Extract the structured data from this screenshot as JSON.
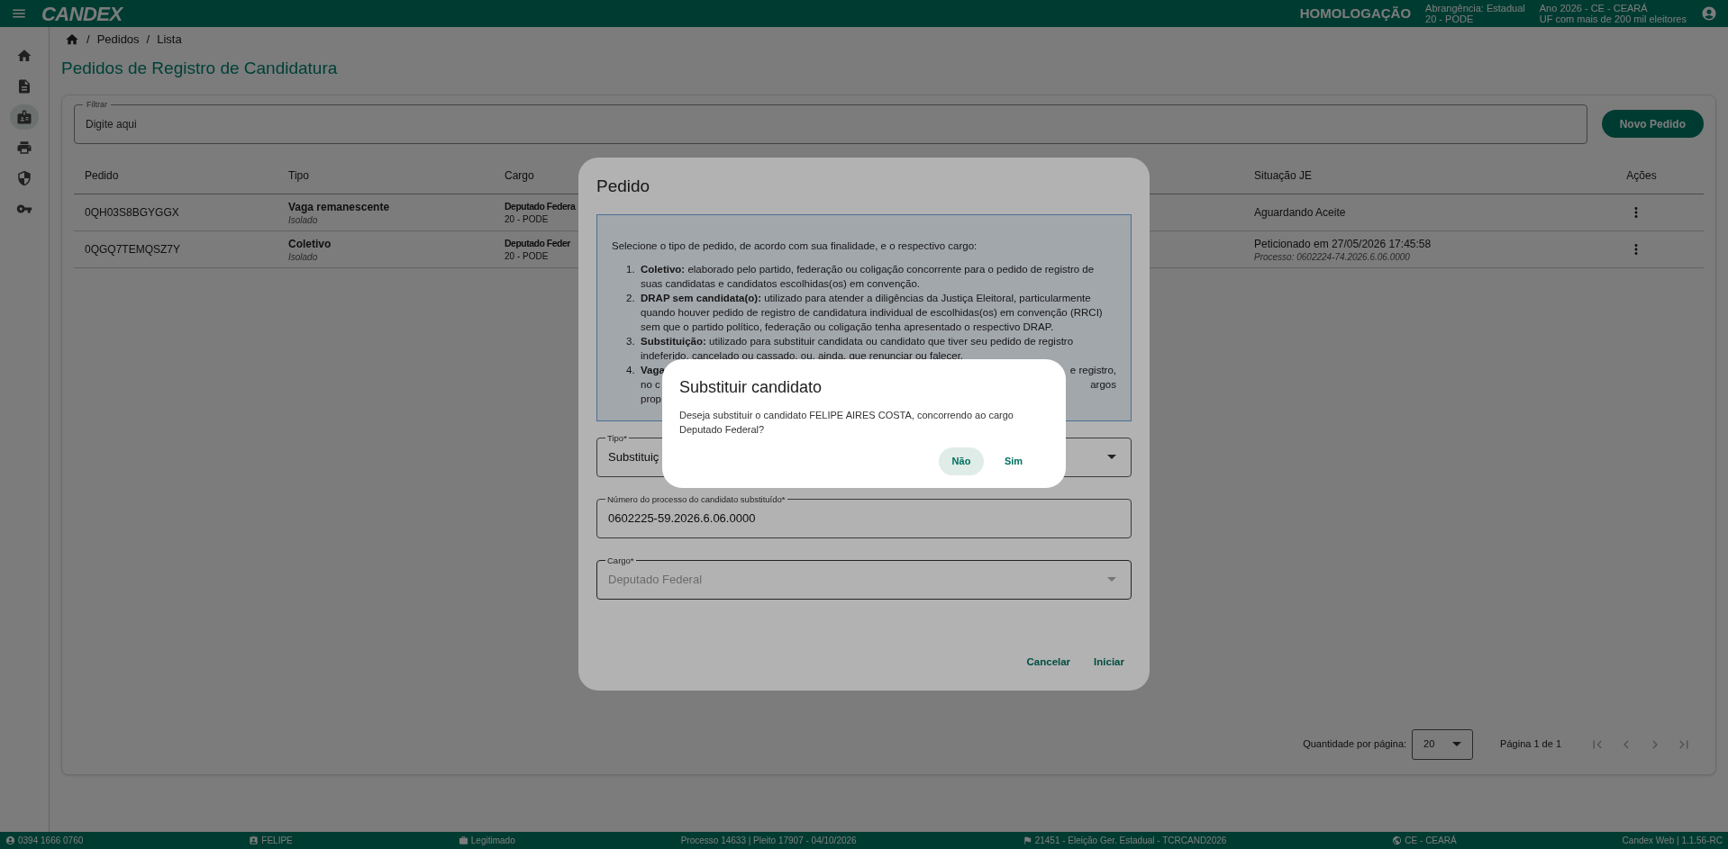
{
  "top_bar": {
    "logo": "CANDEX",
    "environment": "HOMOLOGAÇÃO",
    "scope": [
      "Abrangência: Estadual",
      "20 - PODE"
    ],
    "election": [
      "Ano 2026 - CE - CEARÁ",
      "UF com mais de 200 mil eleitores"
    ]
  },
  "sidebar": {
    "items": [
      {
        "kind": "home",
        "selected": false
      },
      {
        "kind": "document",
        "selected": false
      },
      {
        "kind": "badge",
        "selected": true
      },
      {
        "kind": "print",
        "selected": false
      },
      {
        "kind": "shield",
        "selected": false
      },
      {
        "kind": "key",
        "selected": false
      }
    ]
  },
  "breadcrumb": [
    {
      "separator": "/",
      "label": "Pedidos"
    },
    {
      "separator": "/",
      "label": "Lista"
    }
  ],
  "page_title": "Pedidos de Registro de Candidatura",
  "filter": {
    "label": "Filtrar",
    "placeholder": "Digite aqui"
  },
  "new_button": "Novo Pedido",
  "table": {
    "columns": [
      "Pedido",
      "Tipo",
      "Cargo",
      "Situação JE",
      "Ações"
    ],
    "rows": [
      {
        "pedido": "0QH03S8BGYGGX",
        "tipo": "Vaga remanescente",
        "tipo_sub": "Isolado",
        "cargo": "Deputado Federa",
        "cargo_sub": "20 - PODE",
        "situacao": "Aguardando Aceite"
      },
      {
        "pedido": "0QGQ7TEMQSZ7Y",
        "tipo": "Coletivo",
        "tipo_sub": "Isolado",
        "cargo": "Deputado Feder",
        "cargo_sub": "20 - PODE",
        "situacao": "Peticionado em 27/05/2026 17:45:58",
        "situacao_sub": "Processo: 0602224-74.2026.6.06.0000"
      }
    ]
  },
  "pagination": {
    "page_size_label": "Quantidade por página:",
    "page_size": "20",
    "page_info": "Página 1 de 1",
    "nav": [
      {
        "kind": "first",
        "disabled": true
      },
      {
        "kind": "prev",
        "disabled": true
      },
      {
        "kind": "next",
        "disabled": true
      },
      {
        "kind": "last",
        "disabled": true
      }
    ]
  },
  "pedido_dialog": {
    "title": "Pedido",
    "intro": "Selecione o tipo de pedido, de acordo com sua finalidade, e o respectivo cargo:",
    "items": [
      {
        "number": "1.",
        "text": "**Coletivo:** elaborado pelo partido, federação ou coligação concorrente para o pedido de registro de suas candidatas e candidatos escolhidas(os) em convenção."
      },
      {
        "number": "2.",
        "text": "**DRAP sem candidata(o):** utilizado para atender a diligências da Justiça Eleitoral, particularmente quando houver pedido de registro de candidatura individual de escolhidas(os) em convenção (RRCI) sem que o partido político, federação ou coligação tenha apresentado o respectivo DRAP."
      },
      {
        "number": "3.",
        "text": "**Substituição:** utilizado para substituir candidata ou candidato que tiver seu pedido de registro indeferido, cancelado ou cassado, ou, ainda, que renunciar ou falecer."
      }
    ],
    "partial_item": {
      "number": "4.",
      "lines": [
        [
          "Vaga",
          "e registro,"
        ],
        [
          "no c",
          "argos"
        ],
        [
          "prop"
        ]
      ]
    },
    "fields": [
      {
        "kind": "select",
        "label": "Tipo*",
        "value": "Substituiç",
        "disabled": false
      },
      {
        "kind": "text",
        "label": "Número do processo do candidato substituído*",
        "value": "0602225-59.2026.6.06.0000",
        "disabled": false
      },
      {
        "kind": "select",
        "label": "Cargo*",
        "value": "Deputado Federal",
        "disabled": true
      }
    ],
    "buttons": [
      "Cancelar",
      "Iniciar"
    ]
  },
  "confirm_dialog": {
    "title": "Substituir candidato",
    "message": "Deseja substituir o candidato FELIPE AIRES COSTA, concorrendo ao cargo Deputado Federal?",
    "buttons": [
      {
        "label": "Não",
        "focused": true
      },
      {
        "label": "Sim",
        "focused": false
      }
    ]
  },
  "status_bar": [
    {
      "kind": "account",
      "text": "0394 1666 0760"
    },
    {
      "kind": "badge",
      "text": "FELIPE"
    },
    {
      "kind": "briefcase",
      "text": "Legitimado"
    },
    {
      "kind": "none",
      "text": "Processo 14633 | Pleito 17907 - 04/10/2026"
    },
    {
      "kind": "flag",
      "text": "21451 - Eleição Ger. Estadual - TCRCAND2026"
    },
    {
      "kind": "globe",
      "text": "CE - CEARÁ"
    },
    {
      "kind": "none",
      "text": "Candex Web | 1.1.56-RC"
    }
  ]
}
